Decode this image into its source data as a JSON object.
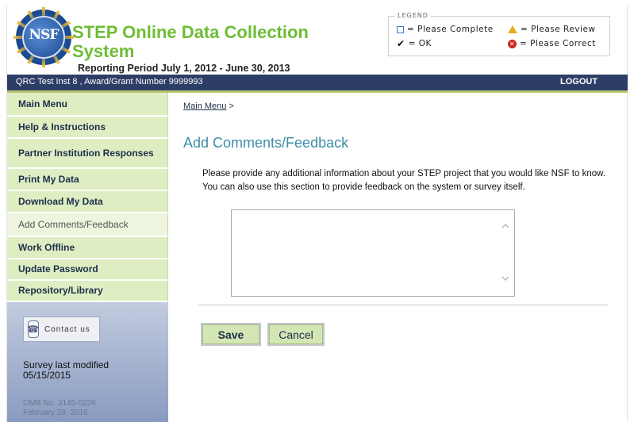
{
  "header": {
    "logo_text": "NSF",
    "app_title": "STEP Online Data Collection System",
    "reporting_period": "Reporting Period July 1, 2012 - June 30, 2013"
  },
  "legend": {
    "title": "LEGEND",
    "items": [
      {
        "icon": "empty-square-icon",
        "label": "= Please Complete"
      },
      {
        "icon": "warning-triangle-icon",
        "label": "= Please Review"
      },
      {
        "icon": "checkmark-icon",
        "label": "= OK"
      },
      {
        "icon": "red-x-circle-icon",
        "label": "= Please Correct"
      }
    ]
  },
  "topbar": {
    "institution": "QRC Test Inst 8 , Award/Grant Number 9999993",
    "logout_label": "LOGOUT",
    "color": "#2d3e66"
  },
  "sidebar": {
    "items": [
      {
        "label": "Main Menu"
      },
      {
        "label": "Help & Instructions"
      },
      {
        "label": "Partner Institution Responses"
      },
      {
        "label": "Print My Data"
      },
      {
        "label": "Download My Data"
      },
      {
        "label": "Add Comments/Feedback",
        "current": true
      },
      {
        "label": "Work Offline"
      },
      {
        "label": "Update Password"
      },
      {
        "label": "Repository/Library"
      }
    ],
    "contact_label": "Contact us",
    "modified_label": "Survey last modified",
    "modified_date": "05/15/2015",
    "omb_number": "OMB No. 3145-0226",
    "omb_date": "February 29, 2016"
  },
  "main": {
    "breadcrumb_link": "Main Menu",
    "breadcrumb_sep": ">",
    "title": "Add Comments/Feedback",
    "instructions": "Please provide any additional information about your STEP project that you would like NSF to know. You can also use this section to provide feedback on the system or survey itself.",
    "feedback_value": "",
    "save_label": "Save",
    "cancel_label": "Cancel"
  },
  "colors": {
    "accent_green": "#6dbd35",
    "nav_green": "#dfeec2",
    "title_teal": "#3d8da8"
  }
}
